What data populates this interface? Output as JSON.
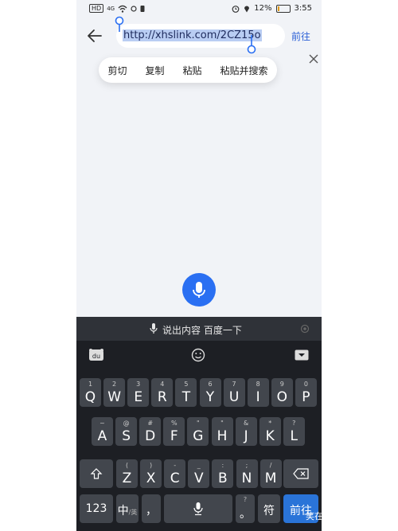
{
  "status_bar": {
    "time": "3:55",
    "battery_percent": "12%",
    "battery_level": 0.12,
    "signal_label": "HD",
    "network": "4G"
  },
  "address_bar": {
    "url": "http://xhslink.com/2CZ15o",
    "go_label": "前往"
  },
  "context_menu": {
    "items": [
      "剪切",
      "复制",
      "粘贴",
      "粘贴并搜索"
    ]
  },
  "voice_bar": {
    "label": "说出内容 百度一下"
  },
  "keyboard": {
    "row1": [
      {
        "sub": "1",
        "main": "Q"
      },
      {
        "sub": "2",
        "main": "W"
      },
      {
        "sub": "3",
        "main": "E"
      },
      {
        "sub": "4",
        "main": "R"
      },
      {
        "sub": "5",
        "main": "T"
      },
      {
        "sub": "6",
        "main": "Y"
      },
      {
        "sub": "7",
        "main": "U"
      },
      {
        "sub": "8",
        "main": "I"
      },
      {
        "sub": "9",
        "main": "O"
      },
      {
        "sub": "0",
        "main": "P"
      }
    ],
    "row2": [
      {
        "sub": "~",
        "main": "A"
      },
      {
        "sub": "@",
        "main": "S"
      },
      {
        "sub": "#",
        "main": "D"
      },
      {
        "sub": "%",
        "main": "F"
      },
      {
        "sub": "\"",
        "main": "G"
      },
      {
        "sub": "\"",
        "main": "H"
      },
      {
        "sub": "&",
        "main": "J"
      },
      {
        "sub": "*",
        "main": "K"
      },
      {
        "sub": "?",
        "main": "L"
      }
    ],
    "row3": [
      {
        "sub": "(",
        "main": "Z"
      },
      {
        "sub": ")",
        "main": "X"
      },
      {
        "sub": "-",
        "main": "C"
      },
      {
        "sub": "_",
        "main": "V"
      },
      {
        "sub": ":",
        "main": "B"
      },
      {
        "sub": ";",
        "main": "N"
      },
      {
        "sub": "/",
        "main": "M"
      }
    ],
    "key_123": "123",
    "key_lang": "中",
    "key_lang_sub": "/英",
    "key_comma": "，",
    "key_period": "。",
    "key_period_sub": "?",
    "key_symbol": "符",
    "key_enter": "前往"
  },
  "watermark": "笑在眉眼处",
  "colors": {
    "accent": "#2a6ff2",
    "keyboard_bg": "#1d1f24",
    "key_bg": "#42464d",
    "selection": "#b9cdf3"
  }
}
